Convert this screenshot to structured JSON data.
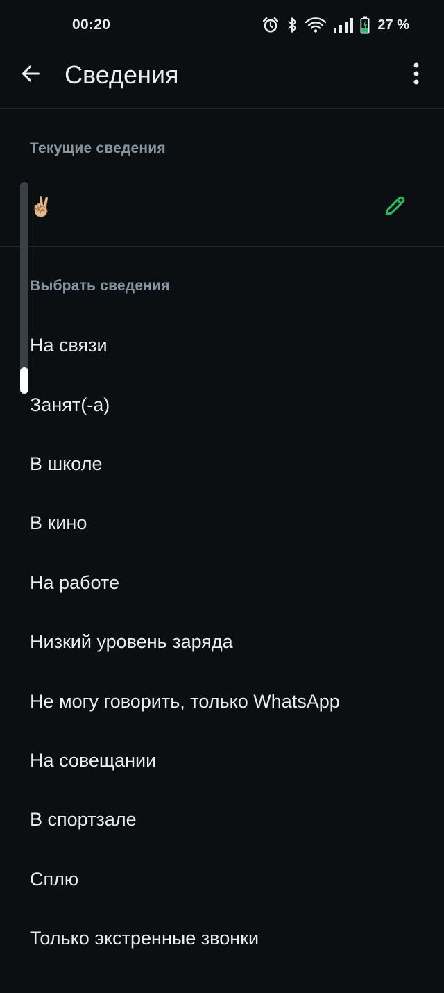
{
  "status_bar": {
    "time": "00:20",
    "icons": [
      "alarm-icon",
      "bluetooth-icon",
      "wifi-icon",
      "signal-icon",
      "battery-charging-icon"
    ],
    "battery_text": "27 %"
  },
  "app_bar": {
    "title": "Сведения",
    "back_icon": "arrow-left-icon",
    "menu_icon": "more-vertical-icon"
  },
  "current": {
    "section_label": "Текущие сведения",
    "value": "✌🏼",
    "edit_icon": "pencil-icon"
  },
  "choose": {
    "section_label": "Выбрать сведения",
    "options": [
      "На связи",
      "Занят(-а)",
      "В школе",
      "В кино",
      "На работе",
      "Низкий уровень заряда",
      "Не могу говорить, только WhatsApp",
      "На совещании",
      "В спортзале",
      "Сплю",
      "Только экстренные звонки"
    ]
  },
  "colors": {
    "background": "#0b0f12",
    "text_primary": "#e9edef",
    "text_secondary": "#8696a0",
    "accent": "#21c063"
  }
}
